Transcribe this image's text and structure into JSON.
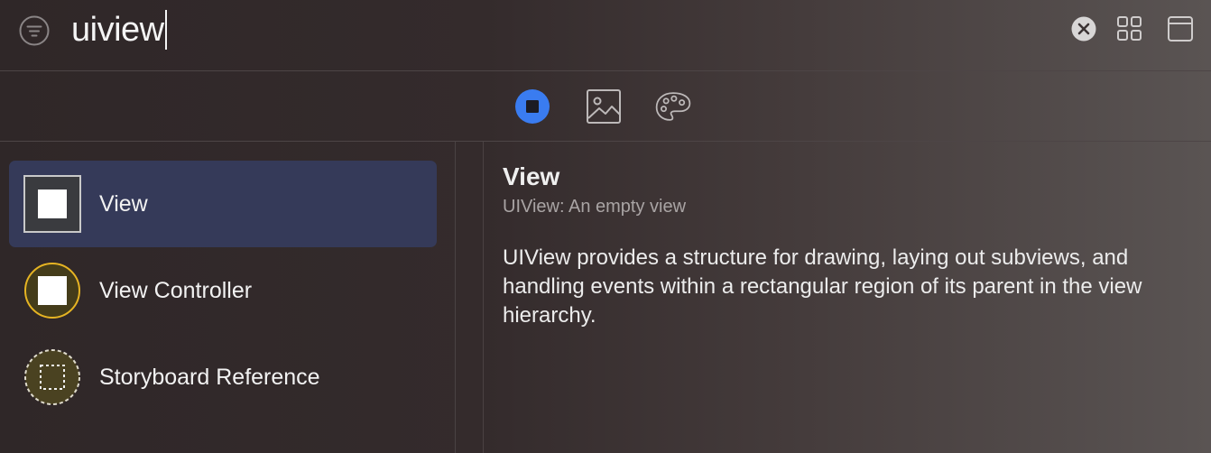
{
  "search": {
    "query": "uiview"
  },
  "toolbar": {
    "filter_icon": "filter-icon",
    "clear_icon": "clear-circle-icon",
    "grid_icon": "grid-view-icon",
    "window_icon": "window-icon"
  },
  "categories": [
    {
      "name": "objects",
      "icon": "square-in-circle-icon",
      "selected": true,
      "color": "#3a7cf0"
    },
    {
      "name": "media",
      "icon": "image-icon",
      "selected": false
    },
    {
      "name": "colors",
      "icon": "palette-icon",
      "selected": false
    }
  ],
  "library": {
    "items": [
      {
        "label": "View",
        "icon": "view-icon",
        "selected": true
      },
      {
        "label": "View Controller",
        "icon": "view-controller-icon",
        "selected": false
      },
      {
        "label": "Storyboard Reference",
        "icon": "storyboard-reference-icon",
        "selected": false
      }
    ]
  },
  "detail": {
    "title": "View",
    "subtitle": "UIView: An empty view",
    "description": "UIView provides a structure for drawing, laying out subviews, and handling events within a rectangular region of its parent in the view hierarchy."
  },
  "colors": {
    "selection": "#353a59",
    "accent": "#3a7cf0",
    "controller_yellow": "#e6b423"
  }
}
